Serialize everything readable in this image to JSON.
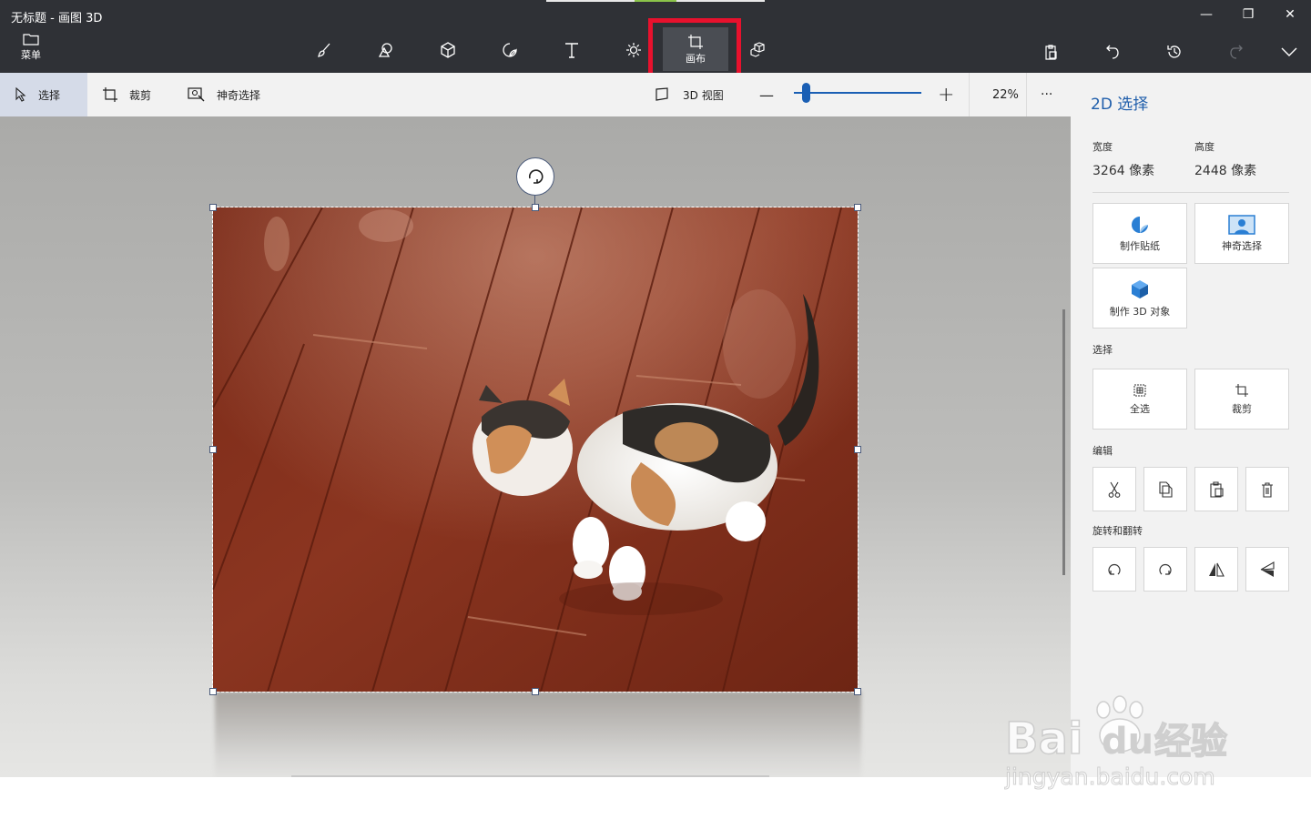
{
  "window": {
    "title": "无标题 - 画图 3D",
    "minimize_glyph": "—",
    "restore_glyph": "❐",
    "close_glyph": "✕"
  },
  "toolbar": {
    "menu_label": "菜单",
    "active_tool_label": "画布",
    "tools": [
      "brush-icon",
      "2d-shapes-icon",
      "3d-shapes-icon",
      "stickers-icon",
      "text-icon",
      "effects-icon",
      "canvas-icon",
      "3d-library-icon"
    ],
    "right_tools": [
      "paste-icon",
      "undo-icon",
      "history-icon",
      "redo-icon",
      "expand-chevron-icon"
    ],
    "highlight_color": "#e8112d"
  },
  "subbar": {
    "select_label": "选择",
    "crop_label": "裁剪",
    "magic_select_label": "神奇选择",
    "view3d_label": "3D 视图",
    "zoom_minus": "—",
    "zoom_plus": "+",
    "zoom_value": "22%",
    "zoom_fraction": 0.09,
    "more_label": "···"
  },
  "panel": {
    "title": "2D 选择",
    "width_label": "宽度",
    "width_value": "3264 像素",
    "height_label": "高度",
    "height_value": "2448 像素",
    "make_sticker": "制作贴纸",
    "magic_select": "神奇选择",
    "make_3d": "制作 3D 对象",
    "select_section": "选择",
    "select_all": "全选",
    "crop": "裁剪",
    "edit_section": "编辑",
    "rotate_section": "旋转和翻转",
    "accent_color": "#1f5eab"
  },
  "watermark": {
    "brand": "Bai",
    "brand2": "du",
    "cn": "经验",
    "url": "jingyan.baidu.com"
  }
}
